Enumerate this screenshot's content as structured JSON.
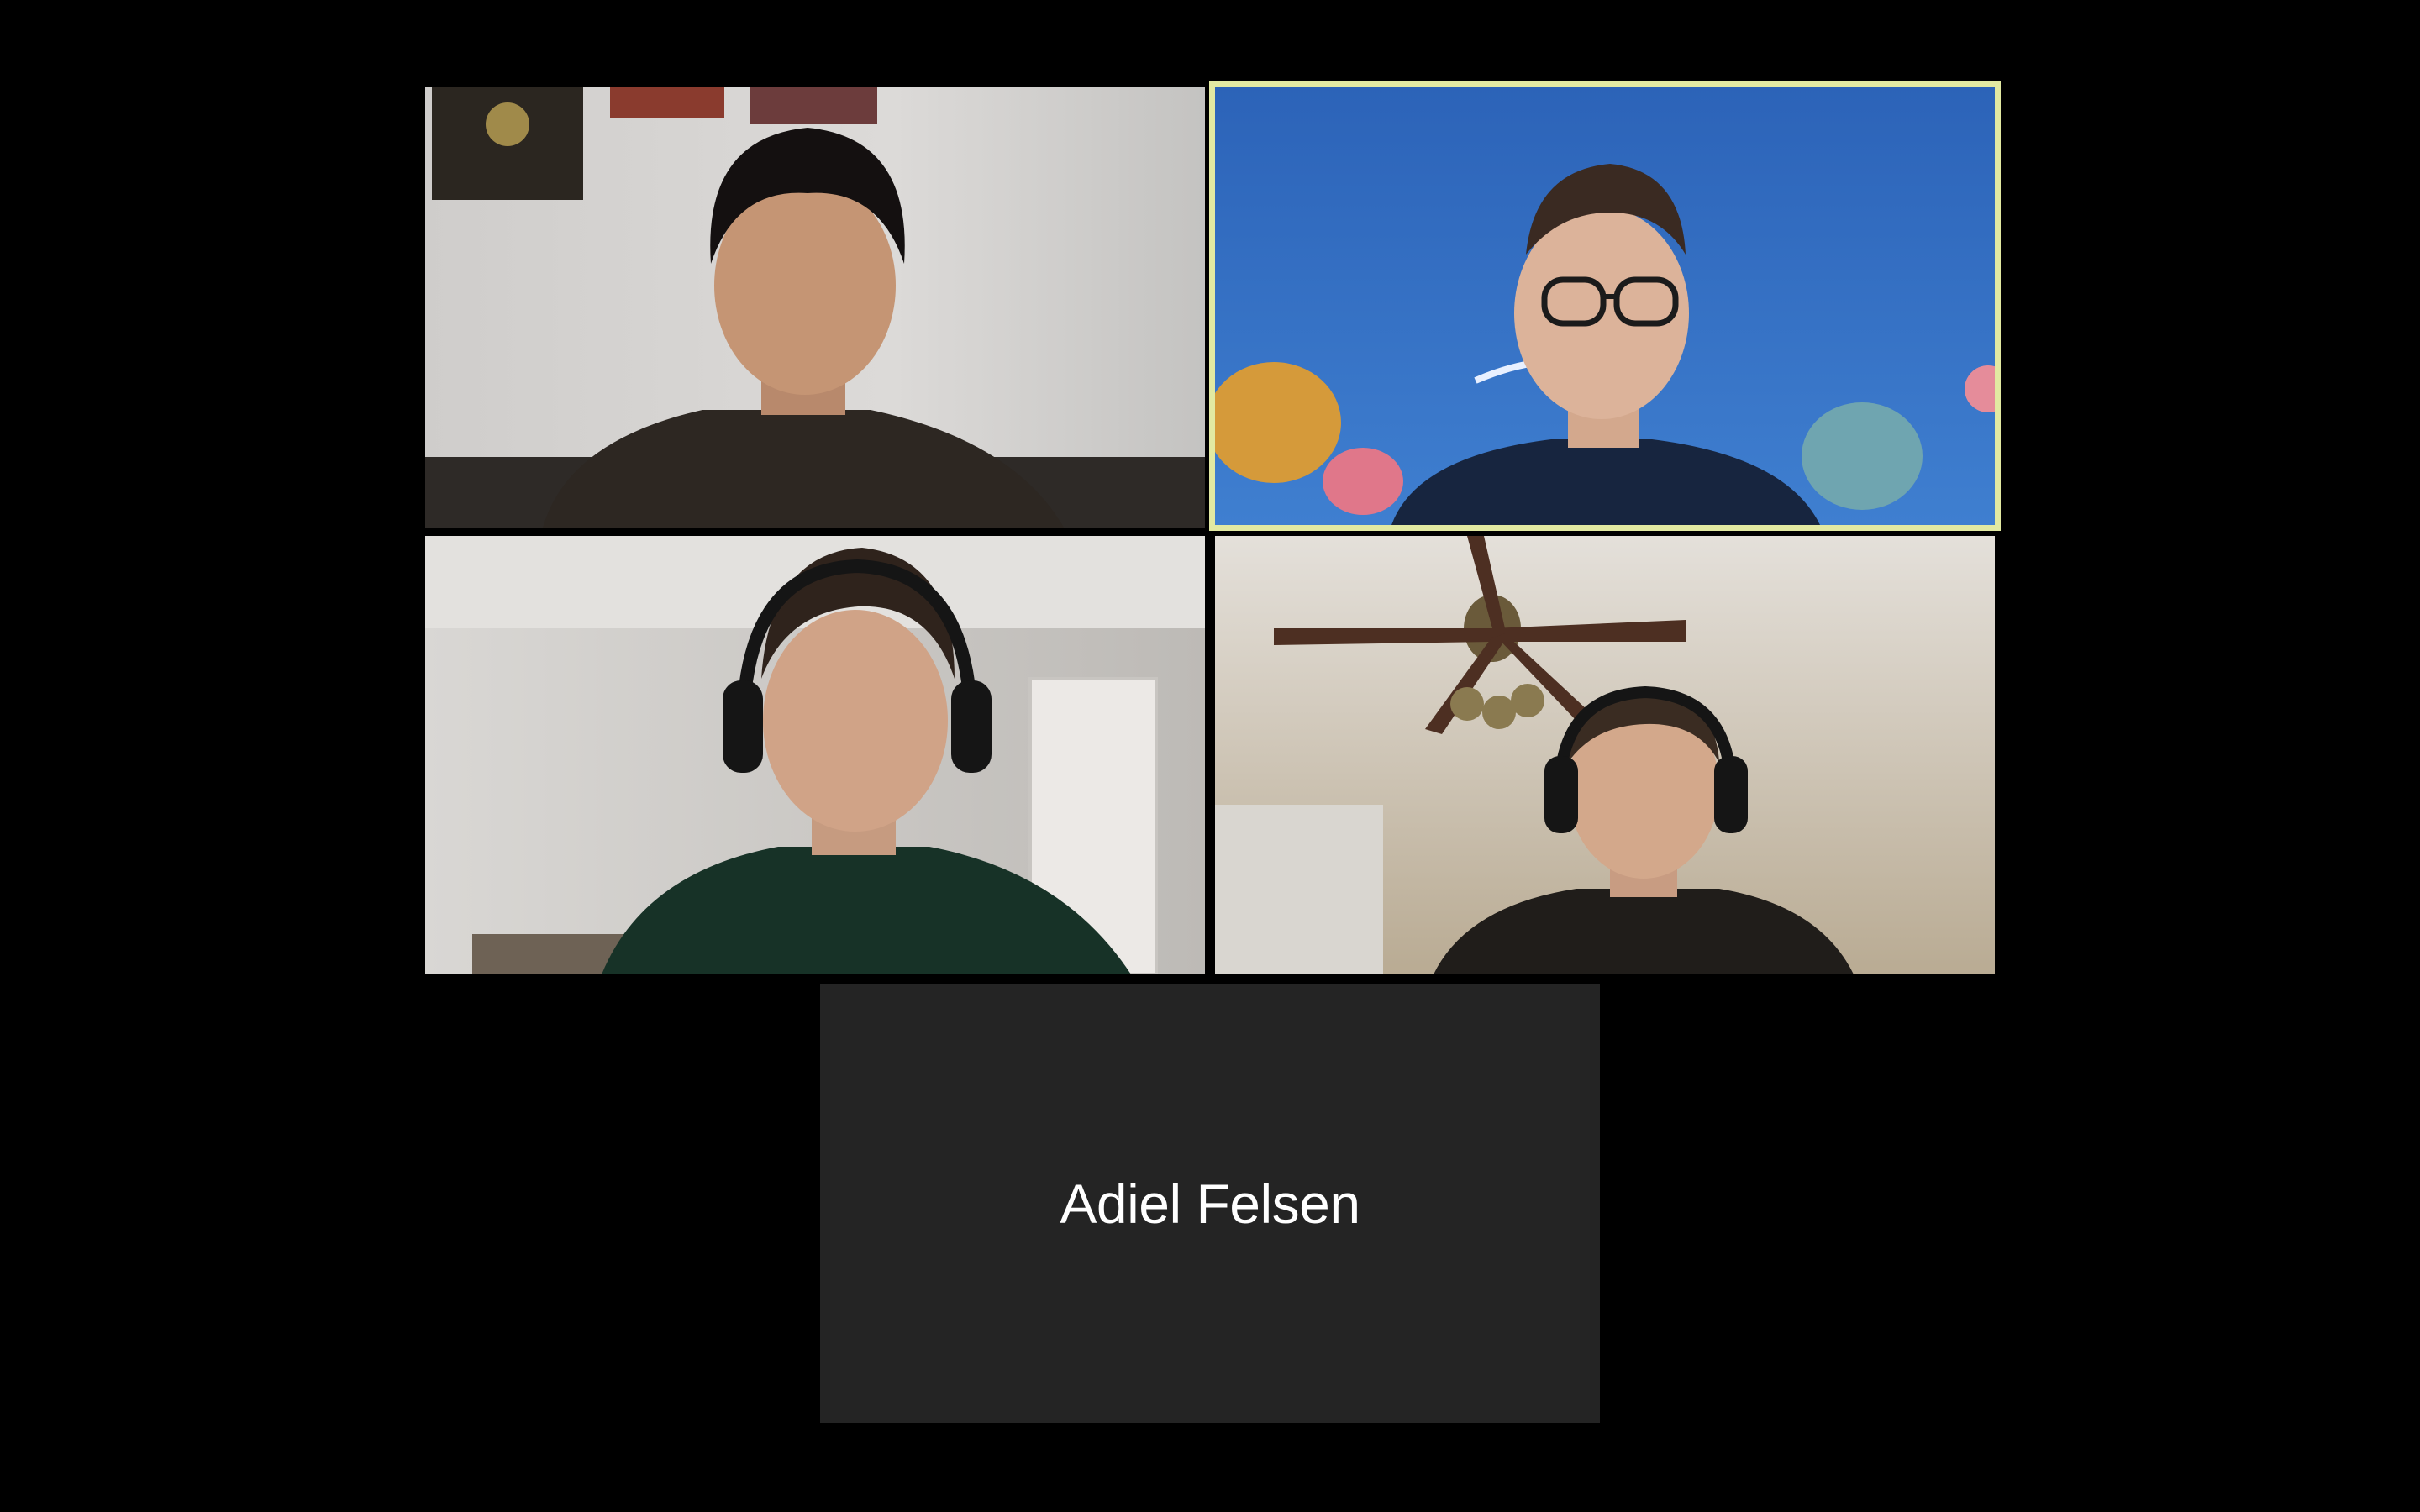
{
  "app": {
    "view": "gallery"
  },
  "colors": {
    "background": "#000000",
    "active_speaker_border": "#e2e9a2",
    "video_off_tile": "#242424",
    "name_text": "#ffffff"
  },
  "participants": [
    {
      "video_on": true,
      "active_speaker": false
    },
    {
      "video_on": true,
      "active_speaker": true
    },
    {
      "video_on": true,
      "active_speaker": false
    },
    {
      "video_on": true,
      "active_speaker": false
    },
    {
      "video_on": false,
      "active_speaker": false,
      "name": "Adiel Felsen"
    }
  ]
}
